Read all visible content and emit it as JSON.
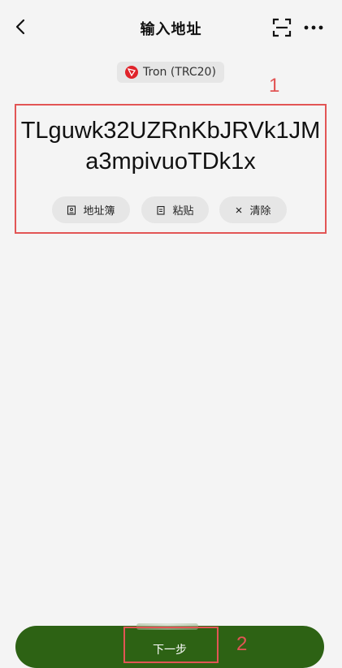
{
  "header": {
    "title": "输入地址",
    "back_icon": "chevron-left-icon",
    "scan_icon": "scan-icon",
    "more_icon": "more-icon"
  },
  "network": {
    "label": "Tron (TRC20)",
    "icon": "tron-icon",
    "color": "#e0232a"
  },
  "address": {
    "value": "TLguwk32UZRnKbJRVk1JMa3mpivuoTDk1x"
  },
  "actions": [
    {
      "label": "地址簿",
      "icon": "address-book-icon"
    },
    {
      "label": "粘贴",
      "icon": "clipboard-icon"
    },
    {
      "label": "清除",
      "icon": "close-icon"
    }
  ],
  "annotations": {
    "first": "1",
    "second": "2",
    "color": "#e25555"
  },
  "footer": {
    "next_label": "下一步",
    "button_color": "#2d6214"
  }
}
